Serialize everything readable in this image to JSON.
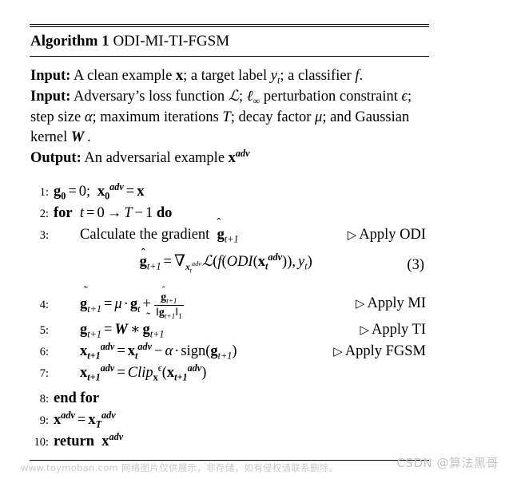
{
  "document": {
    "type": "algorithm-pseudocode-figure",
    "title_label": "Algorithm 1",
    "title_name": "ODI-MI-TI-FGSM"
  },
  "preamble": {
    "input1_keyword": "Input:",
    "input1_text": "A clean example x; a target label y_t; a classifier f.",
    "input2_keyword": "Input:",
    "input2_text": "Adversary's loss function L; ℓ_∞ perturbation constraint ϵ; step size α; maximum iterations T; decay factor μ; and Gaussian kernel W.",
    "output_keyword": "Output:",
    "output_text": "An adversarial example x^adv"
  },
  "steps": [
    {
      "number": "1:",
      "text": "g_0 = 0; x_0^adv = x",
      "comment": ""
    },
    {
      "number": "2:",
      "text": "for t = 0 → T − 1 do",
      "comment": ""
    },
    {
      "number": "3:",
      "text": "Calculate the gradient ĝ_{t+1}",
      "comment": "Apply ODI"
    },
    {
      "number": "4:",
      "text": "g̃_{t+1} = μ · g_t + ĝ_{t+1} / ||ĝ_{t+1}||_1",
      "comment": "Apply MI"
    },
    {
      "number": "5:",
      "text": "g_{t+1} = W * g̃_{t+1}",
      "comment": "Apply TI"
    },
    {
      "number": "6:",
      "text": "x_{t+1}^adv = x_t^adv − α · sign(g_{t+1})",
      "comment": "Apply FGSM"
    },
    {
      "number": "7:",
      "text": "x_{t+1}^adv = Clip_x^ϵ(x_{t+1}^adv)",
      "comment": ""
    },
    {
      "number": "8:",
      "text": "end for",
      "comment": ""
    },
    {
      "number": "9:",
      "text": "x^adv = x_T^adv",
      "comment": ""
    },
    {
      "number": "10:",
      "text": "return x^adv",
      "comment": ""
    }
  ],
  "equation": {
    "number": "(3)",
    "latex": "ĝ_{t+1} = ∇_{x_t^adv} L(f(ODI(x_t^adv)), y_t)"
  },
  "comments": {
    "odi": "Apply ODI",
    "mi": "Apply MI",
    "ti": "Apply TI",
    "fgsm": "Apply FGSM",
    "marker": "▷"
  },
  "numbers": {
    "n1": "1:",
    "n2": "2:",
    "n3": "3:",
    "n4": "4:",
    "n5": "5:",
    "n6": "6:",
    "n7": "7:",
    "n8": "8:",
    "n9": "9:",
    "n10": "10:"
  },
  "keywords": {
    "input": "Input:",
    "output": "Output:",
    "for": "for",
    "do": "do",
    "end_for": "end for",
    "return": "return"
  },
  "footer": {
    "toymoban": "www.toymoban.com 网络图片仅供展示，非存储，如有侵权请联系删除。",
    "csdn": "CSDN @算法黑哥"
  },
  "colors": {
    "text": "#000000",
    "rule": "#000000",
    "watermark_light": "#c9c9c9",
    "watermark_csdn": "#c4c4c4",
    "background": "#ffffff"
  }
}
